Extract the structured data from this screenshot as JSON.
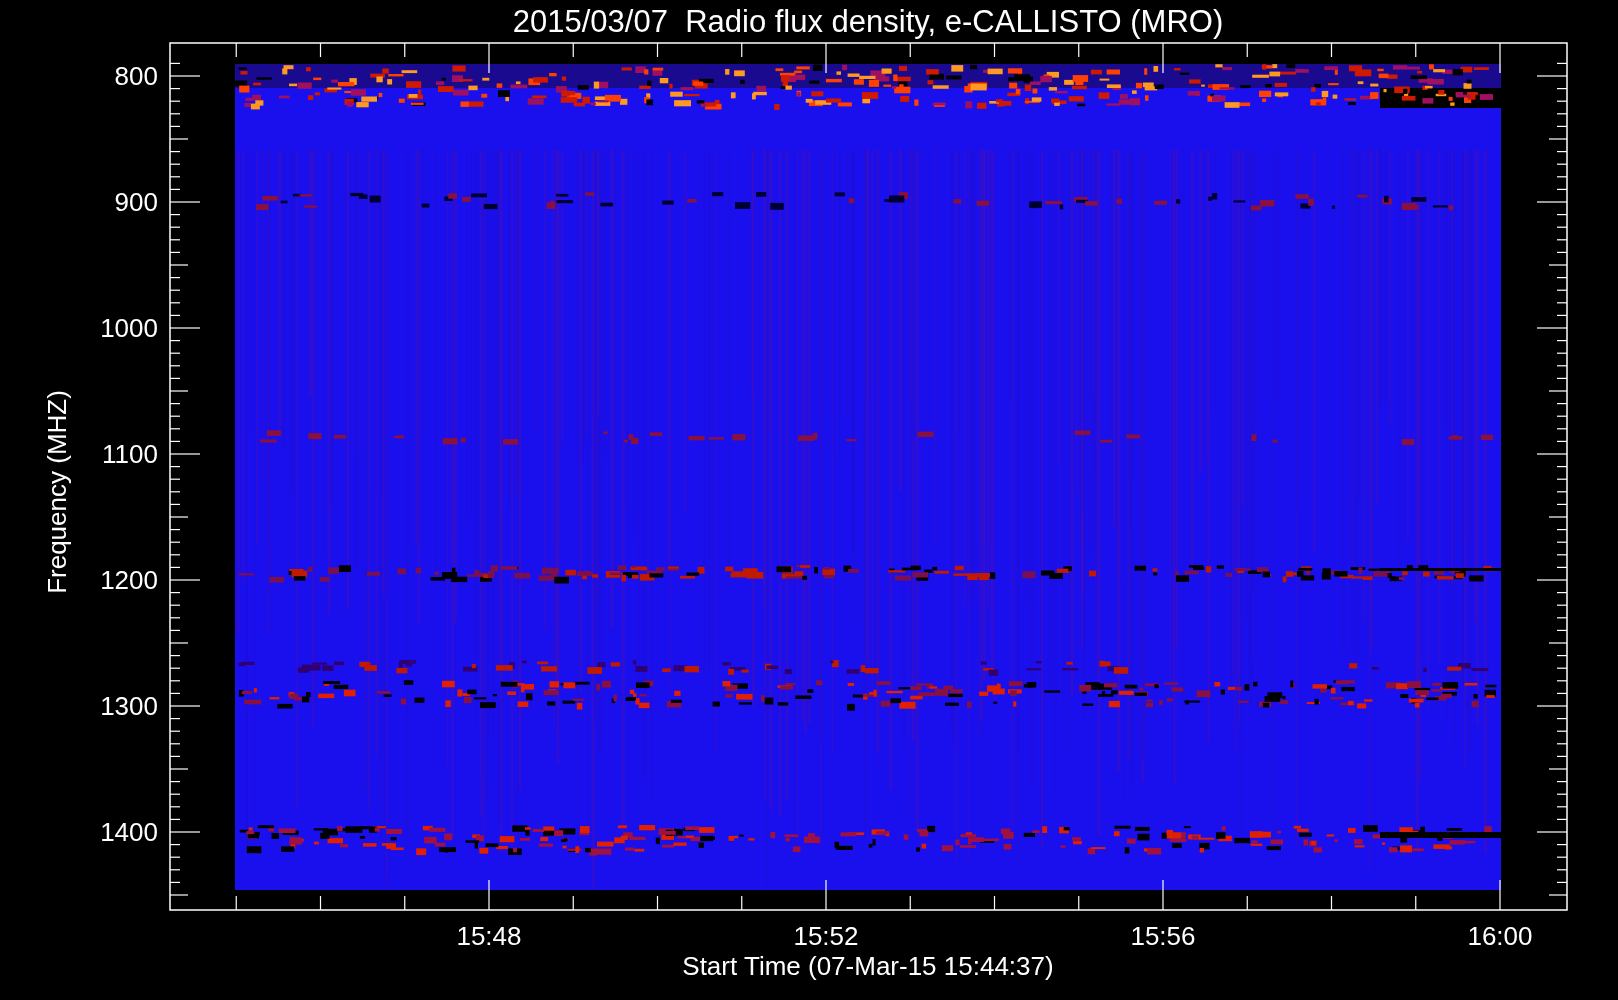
{
  "title": "2015/03/07  Radio flux density, e-CALLISTO (MRO)",
  "y_axis": {
    "label": "Frequency (MHZ)",
    "ticks": [
      "800",
      "900",
      "1000",
      "1100",
      "1200",
      "1300",
      "1400"
    ]
  },
  "x_axis": {
    "label": "Start Time (07-Mar-15 15:44:37)",
    "ticks": [
      "15:48",
      "15:52",
      "15:56",
      "16:00"
    ]
  }
}
